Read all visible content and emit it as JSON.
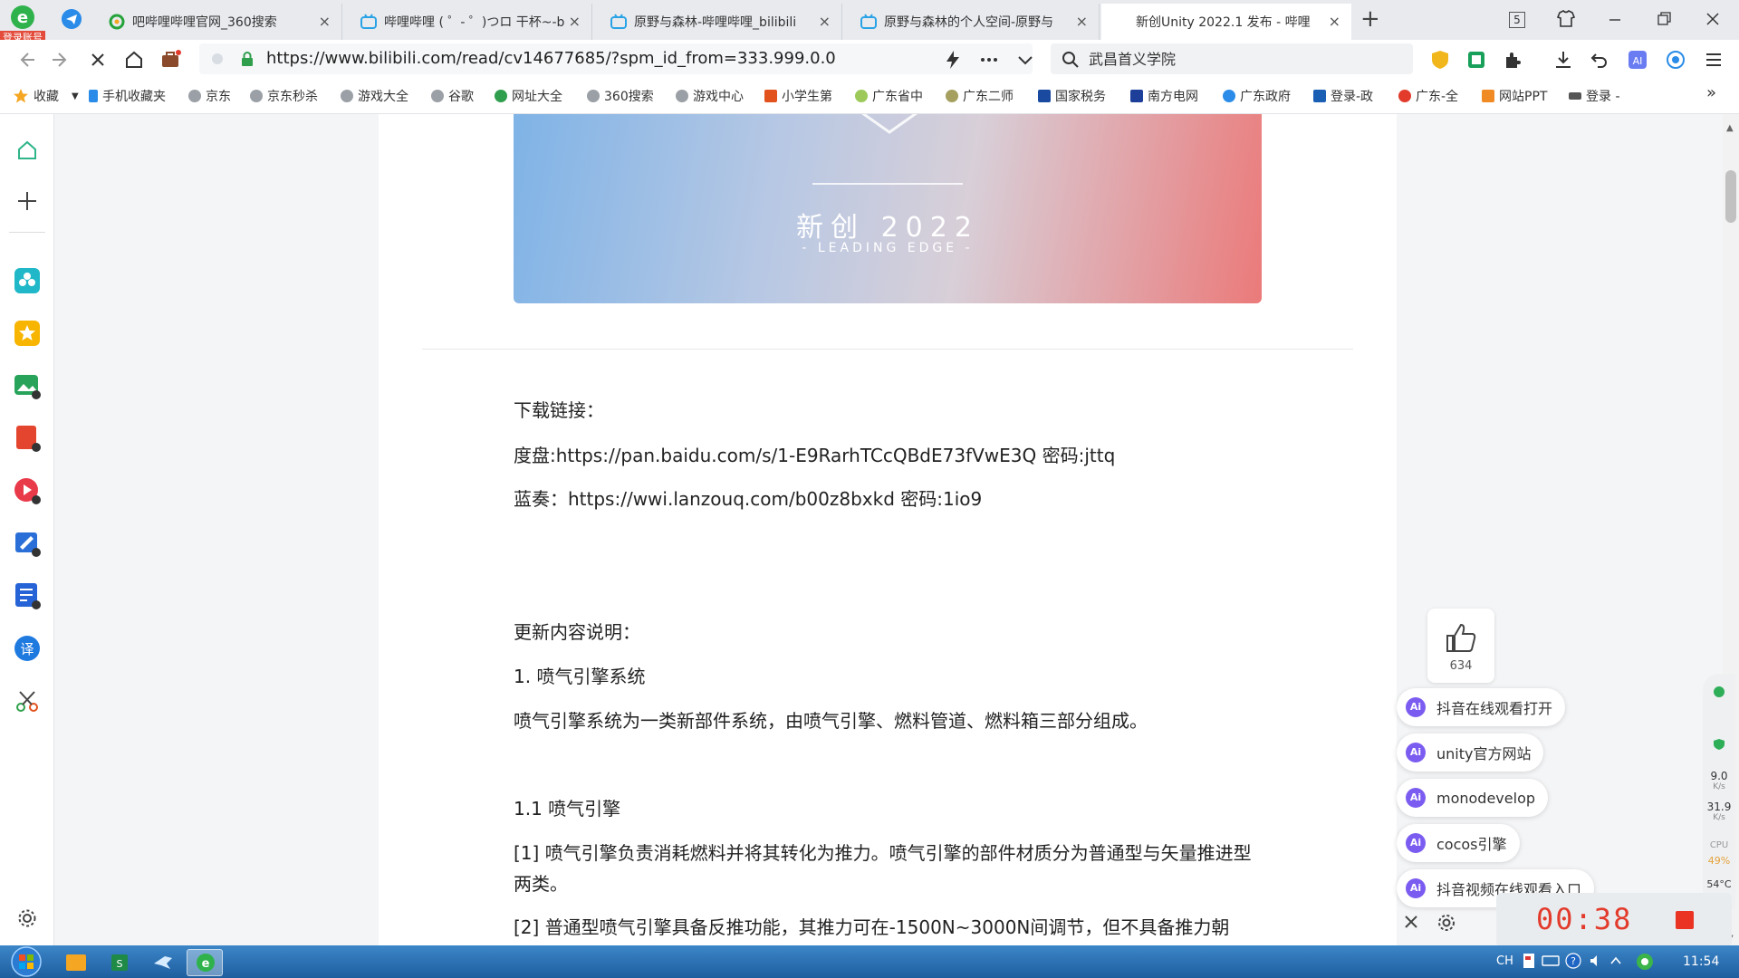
{
  "browser": {
    "login_badge": "登录账号",
    "tabs": [
      {
        "title": "吧哔哩哔哩官网_360搜索",
        "icon": "search-360-icon",
        "close": "×"
      },
      {
        "title": "哔哩哔哩 ( ゜- ゜)つロ 干杯~-b",
        "icon": "bilibili-icon",
        "close": "×"
      },
      {
        "title": "原野与森林-哔哩哔哩_bilibili",
        "icon": "bilibili-icon",
        "close": "×"
      },
      {
        "title": "原野与森林的个人空间-原野与",
        "icon": "bilibili-icon",
        "close": "×"
      },
      {
        "title": "新创Unity 2022.1 发布 - 哔哩",
        "icon": "bilibili-icon",
        "close": "×",
        "active": true
      }
    ],
    "new_tab": "+",
    "window_count": "5",
    "url": "https://www.bilibili.com/read/cv14677685/?spm_id_from=333.999.0.0",
    "search_value": "武昌首义学院",
    "bookmarks": [
      "收藏",
      "手机收藏夹",
      "京东",
      "京东秒杀",
      "游戏大全",
      "谷歌",
      "网址大全",
      "360搜索",
      "游戏中心",
      "小学生第",
      "广东省中",
      "广东二师",
      "国家税务",
      "南方电网",
      "广东政府",
      "登录-政",
      "广东-全",
      "网站PPT",
      "登录 -"
    ],
    "more_bookmarks": "»"
  },
  "article": {
    "banner_title": "新创 2022",
    "banner_subtitle": "- LEADING EDGE -",
    "paragraphs": [
      "下载链接：",
      "度盘:https://pan.baidu.com/s/1-E9RarhTCcQBdE73fVwE3Q 密码:jttq",
      "蓝奏：https://wwi.lanzouq.com/b00z8bxkd 密码:1io9",
      "更新内容说明：",
      "1. 喷气引擎系统",
      "喷气引擎系统为一类新部件系统，由喷气引擎、燃料管道、燃料箱三部分组成。",
      "1.1 喷气引擎",
      "[1] 喷气引擎负责消耗燃料并将其转化为推力。喷气引擎的部件材质分为普通型与矢量推进型两类。",
      "[2] 普通型喷气引擎具备反推功能，其推力可在-1500N~3000N间调节，但不具备推力朝"
    ]
  },
  "like": {
    "count": "634"
  },
  "ai_suggestions": [
    "抖音在线观看打开",
    "unity官方网站",
    "monodevelop",
    "cocos引擎",
    "抖音视频在线观看入口"
  ],
  "ai_badge": "Ai",
  "net_widget": {
    "up": "9.0",
    "up_unit": "K/s",
    "down": "31.9",
    "down_unit": "K/s",
    "cpu": "CPU",
    "cpu_val": "49%",
    "temp": "54°C"
  },
  "recorder": {
    "time": "00:38"
  },
  "taskbar": {
    "lang": "CH",
    "clock": "11:54"
  }
}
